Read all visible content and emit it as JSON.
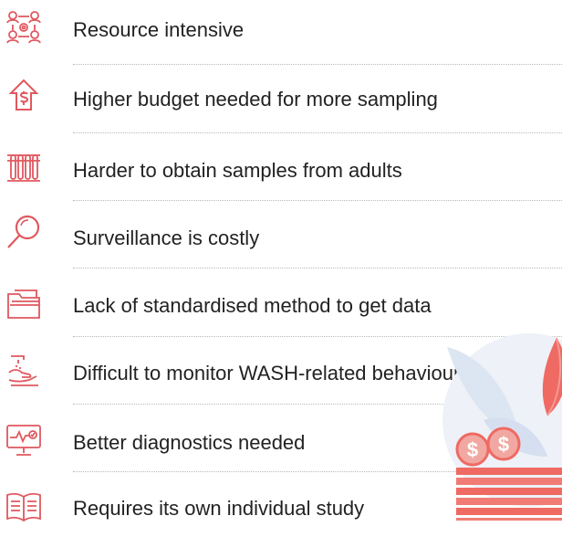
{
  "items": [
    {
      "label": "Resource intensive",
      "icon": "people-network-icon"
    },
    {
      "label": "Higher budget needed for more sampling",
      "icon": "house-dollar-icon"
    },
    {
      "label": "Harder to obtain samples from adults",
      "icon": "test-tubes-icon"
    },
    {
      "label": "Surveillance is costly",
      "icon": "magnifier-icon"
    },
    {
      "label": "Lack of standardised method to get data",
      "icon": "folder-icon"
    },
    {
      "label": "Difficult to monitor WASH-related behaviour",
      "icon": "hand-washing-icon"
    },
    {
      "label": "Better diagnostics needed",
      "icon": "monitor-pulse-icon"
    },
    {
      "label": "Requires its own individual study",
      "icon": "open-book-icon"
    }
  ],
  "colors": {
    "accent": "#e0585f",
    "text": "#222222",
    "divider": "#b9b9b9"
  }
}
